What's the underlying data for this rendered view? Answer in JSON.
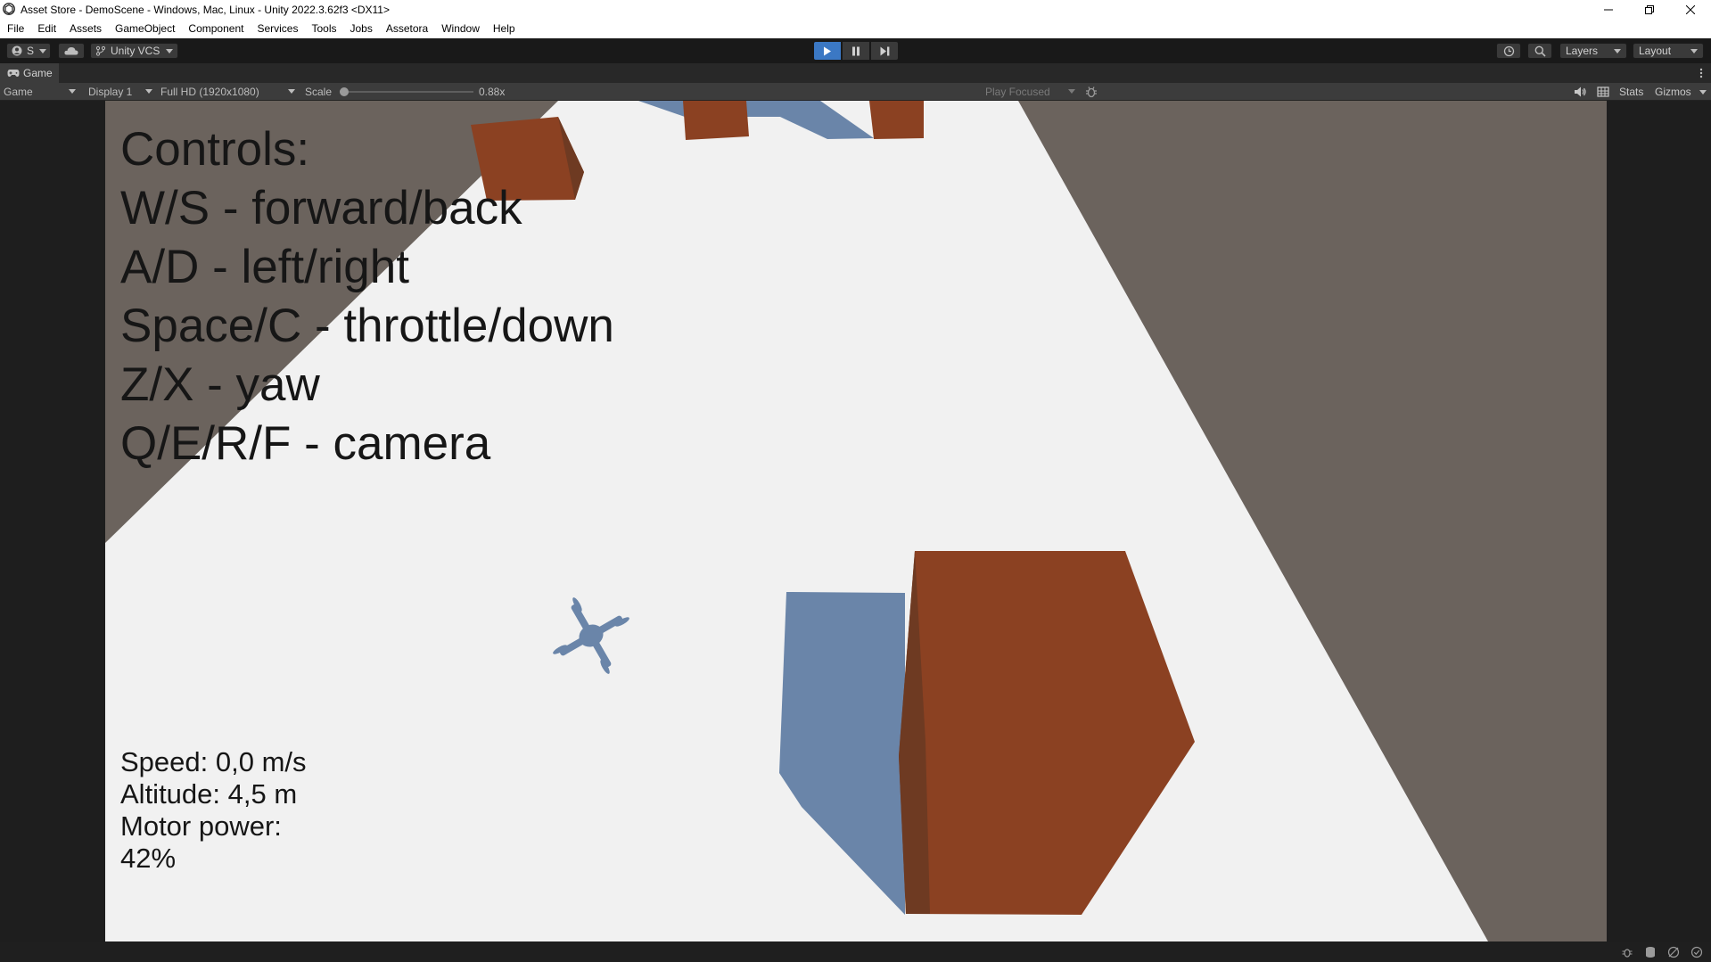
{
  "window": {
    "title": "Asset Store - DemoScene - Windows, Mac, Linux - Unity 2022.3.62f3 <DX11>",
    "logo_icon": "unity-logo-icon",
    "controls": [
      "minimize-icon",
      "restore-icon",
      "close-icon"
    ]
  },
  "menu": [
    "File",
    "Edit",
    "Assets",
    "GameObject",
    "Component",
    "Services",
    "Tools",
    "Jobs",
    "Assetora",
    "Window",
    "Help"
  ],
  "toolbar": {
    "account_label": "S",
    "vcs_label": "Unity VCS",
    "layers_label": "Layers",
    "layout_label": "Layout",
    "accent_color": "#3b78c4"
  },
  "tab": {
    "label": "Game"
  },
  "game_toolbar": {
    "view_mode": "Game",
    "display": "Display 1",
    "resolution": "Full HD (1920x1080)",
    "scale_label": "Scale",
    "scale_value": "0.88x",
    "play_mode": "Play Focused",
    "stats_label": "Stats",
    "gizmos_label": "Gizmos"
  },
  "hud": {
    "controls": [
      "Controls:",
      "W/S - forward/back",
      "A/D - left/right",
      "Space/C - throttle/down",
      "Z/X - yaw",
      "Q/E/R/F - camera"
    ],
    "speed": "Speed: 0,0 m/s",
    "altitude": "Altitude: 4,5 m",
    "motor_label": "Motor power:",
    "motor_value": "42%"
  },
  "colors": {
    "ground": "#f1f1f1",
    "background": "#6b635d",
    "box": "#8b4122",
    "shadow": "#6a85a9"
  }
}
